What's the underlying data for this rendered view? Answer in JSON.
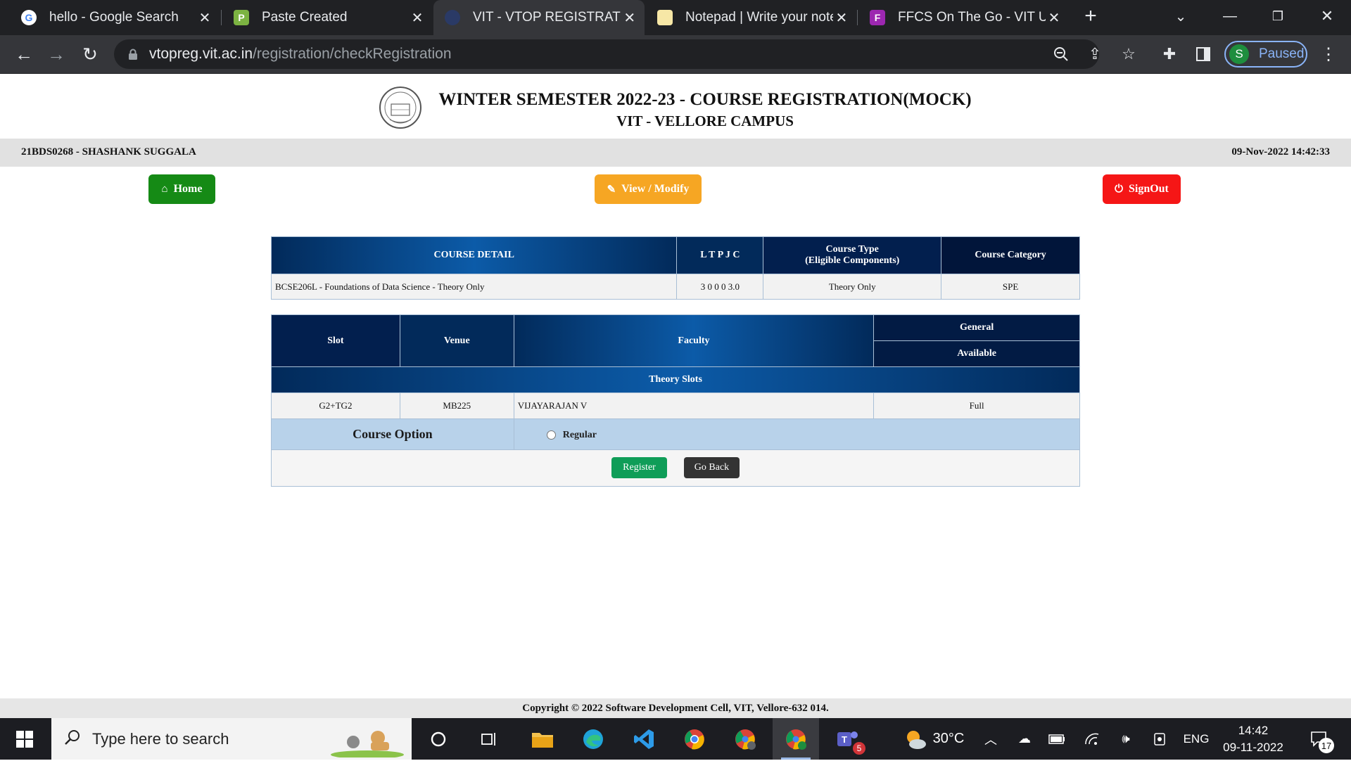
{
  "browser": {
    "tabs": [
      {
        "title": "hello - Google Search",
        "icon": "google-icon",
        "active": false
      },
      {
        "title": "Paste Created",
        "icon": "paste-icon",
        "active": false
      },
      {
        "title": "VIT - VTOP REGISTRATION",
        "icon": "vit-icon",
        "active": true
      },
      {
        "title": "Notepad | Write your notes",
        "icon": "notepad-icon",
        "active": false
      },
      {
        "title": "FFCS On The Go - VIT Uni",
        "icon": "ffcs-icon",
        "active": false
      }
    ],
    "url_host": "vtopreg.vit.ac.in",
    "url_path": "/registration/checkRegistration",
    "profile_initial": "S",
    "profile_status": "Paused"
  },
  "header": {
    "title": "WINTER SEMESTER 2022-23 - COURSE REGISTRATION(MOCK)",
    "campus": "VIT - VELLORE CAMPUS",
    "logo_text": "VIT"
  },
  "infobar": {
    "student": "21BDS0268 - SHASHANK SUGGALA",
    "datetime": "09-Nov-2022 14:42:33"
  },
  "nav": {
    "home": "Home",
    "view_modify": "View / Modify",
    "signout": "SignOut"
  },
  "course_table": {
    "headers": {
      "detail": "COURSE DETAIL",
      "ltpjc": "L T P J C",
      "type_line1": "Course Type",
      "type_line2": "(Eligible Components)",
      "category": "Course Category"
    },
    "row": {
      "detail": "BCSE206L - Foundations of Data Science - Theory Only",
      "ltpjc": "3 0 0 0 3.0",
      "type": "Theory Only",
      "category": "SPE"
    }
  },
  "slot_table": {
    "headers": {
      "slot": "Slot",
      "venue": "Venue",
      "faculty": "Faculty",
      "general": "General",
      "available": "Available",
      "section": "Theory Slots"
    },
    "row": {
      "slot": "G2+TG2",
      "venue": "MB225",
      "faculty": "VIJAYARAJAN V",
      "available": "Full"
    },
    "course_option_label": "Course Option",
    "option_regular": "Regular",
    "register": "Register",
    "go_back": "Go Back"
  },
  "footer": "Copyright © 2022 Software Development Cell, VIT, Vellore-632 014.",
  "taskbar": {
    "search_placeholder": "Type here to search",
    "weather": "30°C",
    "language": "ENG",
    "time": "14:42",
    "date": "09-11-2022",
    "teams_badge": "5",
    "notification_count": "17"
  },
  "colors": {
    "home": "#158a15",
    "view_modify": "#f6a623",
    "signout": "#f51616",
    "register": "#0f9d58",
    "go_back": "#333333"
  }
}
